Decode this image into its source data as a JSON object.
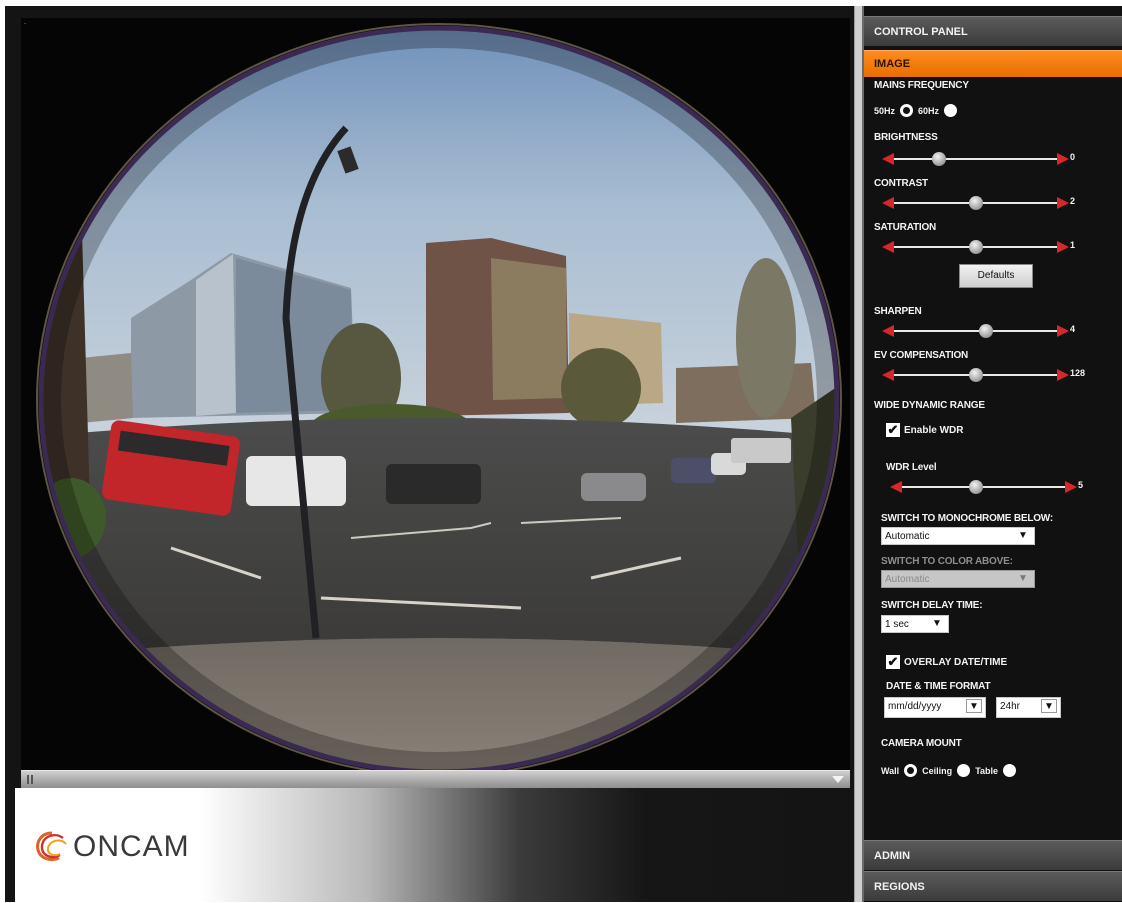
{
  "logo": {
    "text": "ONCAM"
  },
  "panel": {
    "title": "CONTROL PANEL",
    "section": "IMAGE",
    "mains_frequency": {
      "label": "MAINS FREQUENCY",
      "options": [
        "50Hz",
        "60Hz"
      ],
      "selected": "50Hz"
    },
    "brightness": {
      "label": "BRIGHTNESS",
      "value": "0",
      "position": 0.25
    },
    "contrast": {
      "label": "CONTRAST",
      "value": "2",
      "position": 0.5
    },
    "saturation": {
      "label": "SATURATION",
      "value": "1",
      "position": 0.5
    },
    "defaults_button": "Defaults",
    "sharpen": {
      "label": "SHARPEN",
      "value": "4",
      "position": 0.55
    },
    "ev_compensation": {
      "label": "EV COMPENSATION",
      "value": "128",
      "position": 0.5
    },
    "wdr": {
      "label": "WIDE DYNAMIC RANGE",
      "enable_label": "Enable WDR",
      "enabled": true,
      "level_label": "WDR Level",
      "level_value": "5",
      "level_position": 0.5
    },
    "mono_below": {
      "label": "SWITCH TO MONOCHROME BELOW:",
      "value": "Automatic"
    },
    "color_above": {
      "label": "SWITCH TO COLOR ABOVE:",
      "value": "Automatic",
      "disabled": true
    },
    "delay": {
      "label": "SWITCH DELAY TIME:",
      "value": "1 sec"
    },
    "overlay": {
      "label": "OVERLAY DATE/TIME",
      "checked": true
    },
    "datetime_format": {
      "label": "DATE & TIME FORMAT",
      "date_value": "mm/dd/yyyy",
      "time_value": "24hr"
    },
    "camera_mount": {
      "label": "CAMERA MOUNT",
      "options": [
        "Wall",
        "Ceiling",
        "Table"
      ],
      "selected": "Wall"
    },
    "admin": "ADMIN",
    "regions": "REGIONS"
  },
  "colors": {
    "accent": "#f08000",
    "slider_arrow": "#d8272b",
    "panel_bg": "#111111"
  },
  "icons": {
    "slider_left": "arrow-left-icon",
    "slider_right": "arrow-right-icon",
    "dropdown": "chevron-down-icon"
  }
}
